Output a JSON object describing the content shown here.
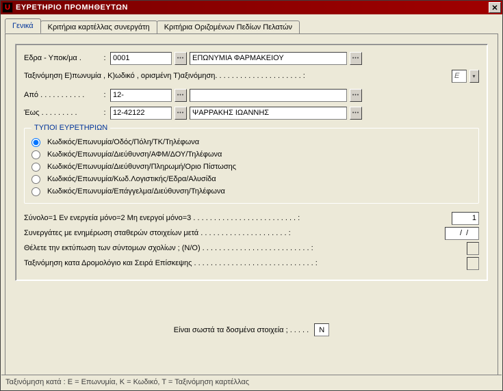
{
  "window": {
    "title": "ΕΥΡΕΤΗΡΙΟ ΠΡΟΜΗΘΕΥΤΩΝ",
    "icon_letter": "U"
  },
  "tabs": {
    "t1": "Γενικά",
    "t2": "Κριτήρια καρτέλλας συνεργάτη",
    "t3": "Κριτήρια Οριζομένων Πεδίων Πελατών"
  },
  "labels": {
    "edra": "Εδρα - Υποκ/μα .",
    "colon": ":",
    "tax": "Ταξινόμηση Ε)πωνυμία , Κ)ωδικό , ορισμένη Τ)αξινόμηση. . . . . . . . . . . . . . . . . . . . . :",
    "apo": "Από . . . . . . . . . . .",
    "eos": "Έως . . . . . . . . . ",
    "types_legend": "ΤΥΠΟΙ ΕΥΡΕΤΗΡΙΩΝ",
    "r1": "Κωδικός/Επωνυμία/Οδός/Πόλη/ΤΚ/Τηλέφωνα",
    "r2": "Κωδικός/Επωνυμία/Διεύθυνση/ΑΦΜ/ΔΟΥ/Τηλέφωνα",
    "r3": "Κωδικός/Επωνυμία/Διεύθυνση/Πληρωμή/Οριο Πίστωσης",
    "r4": "Κωδικός/Επωνυμία/Κωδ.Λογιστικής/Εδρα/Αλυσίδα",
    "r5": "Κωδικός/Επωνυμία/Επάγγελμα/Διεύθυνση/Τηλέφωνα",
    "synolo": "Σύνολο=1  Εν ενεργεία μόνο=2  Μη ενεργοί μόνο=3 . . . . . . . . . . . . . . . . . . . . . . . . .   :",
    "synerg": "Συνεργάτες με ενημέρωση σταθερών στοιχείων μετά . . . . . . . . . . . . . . . . . . . . .  :",
    "thelete": "Θέλετε την εκτύπωση των σύντομων σχολίων ; (Ν/Ο) . . . . . . . . . . . . . . . . . . . . . . . . . .   :",
    "taxkata": "Ταξινόμηση κατα Δρομολόγιο και Σειρά Επίσκεψης . . . . . . . . . . . . . . . . . . . . . . . . . . . . .  :",
    "confirm": "Είναι σωστά τα δοσμένα στοιχεία ; . . . . .",
    "status": "Ταξινόμηση κατά : Ε = Επωνυμία, Κ = Κωδικό,   Τ = Ταξινόμηση καρτέλλας"
  },
  "fields": {
    "edra_code": "0001",
    "edra_name": "ΕΠΩΝΥΜΙΑ ΦΑΡΜΑΚΕΙΟΥ",
    "tax_val": "Ε",
    "apo_code": "12-",
    "apo_name": "",
    "eos_code": "12-42122",
    "eos_name": "ΨΑΡΡΑΚΗΣ ΙΩΑΝΝΗΣ",
    "synolo_val": "1",
    "date_val": "  /  /",
    "thelete_val": "",
    "taxkata_val": "",
    "confirm_val": "Ν"
  }
}
